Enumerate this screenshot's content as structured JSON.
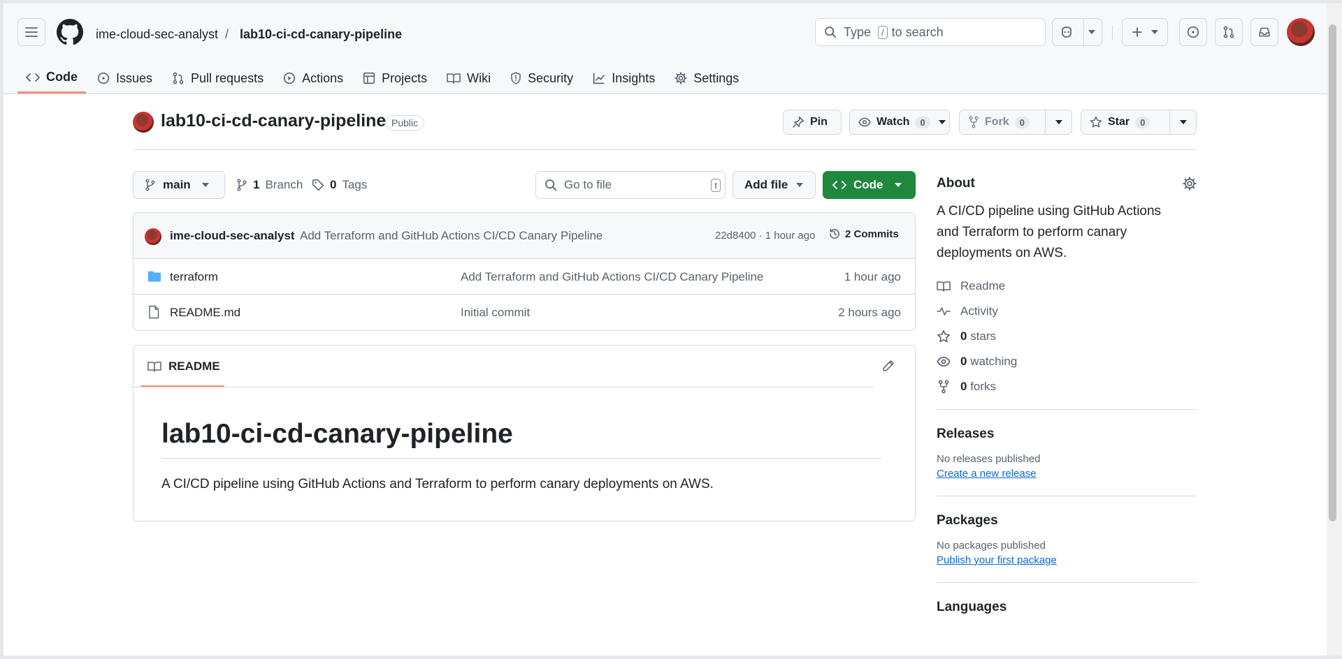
{
  "header": {
    "owner": "ime-cloud-sec-analyst",
    "separator": "/",
    "repo": "lab10-ci-cd-canary-pipeline",
    "search_prefix": "Type",
    "search_key": "/",
    "search_suffix": "to search"
  },
  "tabs": [
    {
      "label": "Code",
      "icon": "code-icon"
    },
    {
      "label": "Issues",
      "icon": "issue-icon"
    },
    {
      "label": "Pull requests",
      "icon": "pull-request-icon"
    },
    {
      "label": "Actions",
      "icon": "play-icon"
    },
    {
      "label": "Projects",
      "icon": "table-icon"
    },
    {
      "label": "Wiki",
      "icon": "book-icon"
    },
    {
      "label": "Security",
      "icon": "shield-icon"
    },
    {
      "label": "Insights",
      "icon": "graph-icon"
    },
    {
      "label": "Settings",
      "icon": "gear-icon"
    }
  ],
  "repo_head": {
    "title": "lab10-ci-cd-canary-pipeline",
    "visibility": "Public",
    "pin": "Pin",
    "watch": "Watch",
    "watch_count": "0",
    "fork": "Fork",
    "fork_count": "0",
    "star": "Star",
    "star_count": "0"
  },
  "toolbar": {
    "branch": "main",
    "branches_count": "1",
    "branches_label": "Branch",
    "tags_count": "0",
    "tags_label": "Tags",
    "goto_placeholder": "Go to file",
    "goto_key": "t",
    "add_file": "Add file",
    "code": "Code"
  },
  "commit": {
    "author": "ime-cloud-sec-analyst",
    "message": "Add Terraform and GitHub Actions CI/CD Canary Pipeline",
    "hash_time": "22d8400 · 1 hour ago",
    "commits": "2 Commits"
  },
  "files": [
    {
      "name": "terraform",
      "type": "folder",
      "message": "Add Terraform and GitHub Actions CI/CD Canary Pipeline",
      "time": "1 hour ago"
    },
    {
      "name": "README.md",
      "type": "file",
      "message": "Initial commit",
      "time": "2 hours ago"
    }
  ],
  "readme": {
    "tab": "README",
    "heading": "lab10-ci-cd-canary-pipeline",
    "body": "A CI/CD pipeline using GitHub Actions and Terraform to perform canary deployments on AWS."
  },
  "about": {
    "title": "About",
    "description": "A CI/CD pipeline using GitHub Actions and Terraform to perform canary deployments on AWS.",
    "readme": "Readme",
    "activity": "Activity",
    "stars_count": "0",
    "stars_label": "stars",
    "watching_count": "0",
    "watching_label": "watching",
    "forks_count": "0",
    "forks_label": "forks"
  },
  "releases": {
    "title": "Releases",
    "none": "No releases published",
    "link": "Create a new release"
  },
  "packages": {
    "title": "Packages",
    "none": "No packages published",
    "link": "Publish your first package"
  },
  "languages": {
    "title": "Languages"
  },
  "colors": {
    "accent": "#fd8c73",
    "primary": "#1f883d",
    "link": "#0969da",
    "folder": "#54aeff"
  }
}
